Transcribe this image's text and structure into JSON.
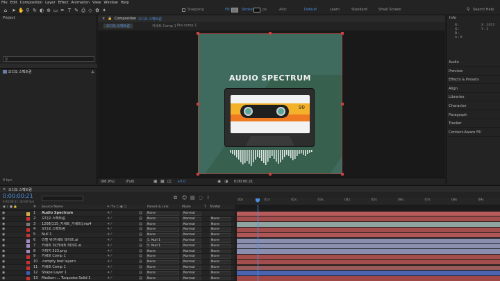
{
  "menu": [
    "File",
    "Edit",
    "Composition",
    "Layer",
    "Effect",
    "Animation",
    "View",
    "Window",
    "Help"
  ],
  "toolbar": {
    "snapping": "Snapping",
    "fill": "Fill:",
    "stroke": "Stroke:",
    "stroke_px": "px",
    "add": "Add:",
    "workspaces": [
      "Default",
      "Learn",
      "Standard",
      "Small Screen"
    ],
    "search_placeholder": "Search Help"
  },
  "project": {
    "title": "Project",
    "item": "오디오 스펙트럼"
  },
  "composition": {
    "tab_label": "Composition",
    "comp_name": "오디오 스펙트럼",
    "breadcrumbs": [
      "오디오 스펙트럼",
      "카세트 Comp 1",
      "Pre-comp 1"
    ],
    "footer_zoom": "(66.9%)",
    "footer_res": "(Full)",
    "footer_time": "0:00:00:21",
    "footer_exposure": "+0.0",
    "art_title": "AUDIO SPECTRUM",
    "tape_number": "90",
    "colors": {
      "bg": "#3f6b5e",
      "stage": "#191919",
      "dark": "#2a4840"
    }
  },
  "right_panel": {
    "info_title": "Info",
    "rgb": [
      "R :",
      "G :",
      "B :",
      "A : 0"
    ],
    "xy": [
      "X : 1017",
      "Y : 1"
    ],
    "items": [
      "Audio",
      "Preview",
      "Effects & Presets",
      "Align",
      "Libraries",
      "Character",
      "Paragraph",
      "Tracker",
      "Content-Aware Fill"
    ]
  },
  "timeline": {
    "tab": "오디오 스펙트럼",
    "timecode": "0:00:00:21",
    "fps": "0:00:00:21 (30.00 fps)",
    "headers": {
      "num": "#",
      "source": "Source Name",
      "parent": "Parent & Link",
      "mode": "Mode",
      "t": "T",
      "trkmat": "TrkMat"
    },
    "ruler": [
      "00s",
      "01s",
      "02s",
      "03s",
      "04s",
      "05s",
      "06s",
      "07s",
      "08s",
      "09s"
    ],
    "layers": [
      {
        "num": "1",
        "name": "Audio Spectrum",
        "color": "#d7b44a",
        "parent": "None",
        "mode": "Normal",
        "trk": "",
        "bar": "#b85b5b"
      },
      {
        "num": "2",
        "name": "오디오 스펙트럼",
        "color": "#c83232",
        "parent": "None",
        "mode": "Normal",
        "trk": "None",
        "bar": "#a34d4d"
      },
      {
        "num": "3",
        "name": "1208[115_카세트_가세트].mp4",
        "color": "#7a7a7a",
        "parent": "None",
        "mode": "Normal",
        "trk": "None",
        "bar": "#8fa3a0"
      },
      {
        "num": "4",
        "name": "오디오 스펙트럼",
        "color": "#c83232",
        "parent": "None",
        "mode": "Normal",
        "trk": "None",
        "bar": "#a34d4d"
      },
      {
        "num": "5",
        "name": "Null 1",
        "color": "#c83232",
        "parent": "None",
        "mode": "Normal",
        "trk": "None",
        "bar": "#b05656"
      },
      {
        "num": "6",
        "name": "라벨 위(카세트 테이프.ai",
        "color": "#a08ac0",
        "parent": "5. Null 1",
        "mode": "Normal",
        "trk": "None",
        "bar": "#8a8fb0"
      },
      {
        "num": "7",
        "name": "카세트 뒤(카세트 테이프.ai",
        "color": "#a08ac0",
        "parent": "5. Null 1",
        "mode": "Normal",
        "trk": "None",
        "bar": "#8a8fb0"
      },
      {
        "num": "8",
        "name": "이미지 323.png",
        "color": "#a08ac0",
        "parent": "None",
        "mode": "Normal",
        "trk": "None",
        "bar": "#8a8fb0"
      },
      {
        "num": "9",
        "name": "카세트 Comp 1",
        "color": "#c83232",
        "parent": "None",
        "mode": "Normal",
        "trk": "None",
        "bar": "#a34d4d"
      },
      {
        "num": "10",
        "name": "<empty text layer>",
        "color": "#c83232",
        "parent": "None",
        "mode": "Normal",
        "trk": "None",
        "bar": "#a34d4d"
      },
      {
        "num": "11",
        "name": "카세트 Comp 1",
        "color": "#c83232",
        "parent": "None",
        "mode": "Normal",
        "trk": "None",
        "bar": "#9a5a5a"
      },
      {
        "num": "12",
        "name": "Shape Layer 1",
        "color": "#3f5fb0",
        "parent": "None",
        "mode": "Normal",
        "trk": "None",
        "bar": "#4a64b0"
      },
      {
        "num": "13",
        "name": "Medium ... Turquoise Solid 1",
        "color": "#c83232",
        "parent": "None",
        "mode": "Normal",
        "trk": "None",
        "bar": "#a04848"
      }
    ]
  }
}
